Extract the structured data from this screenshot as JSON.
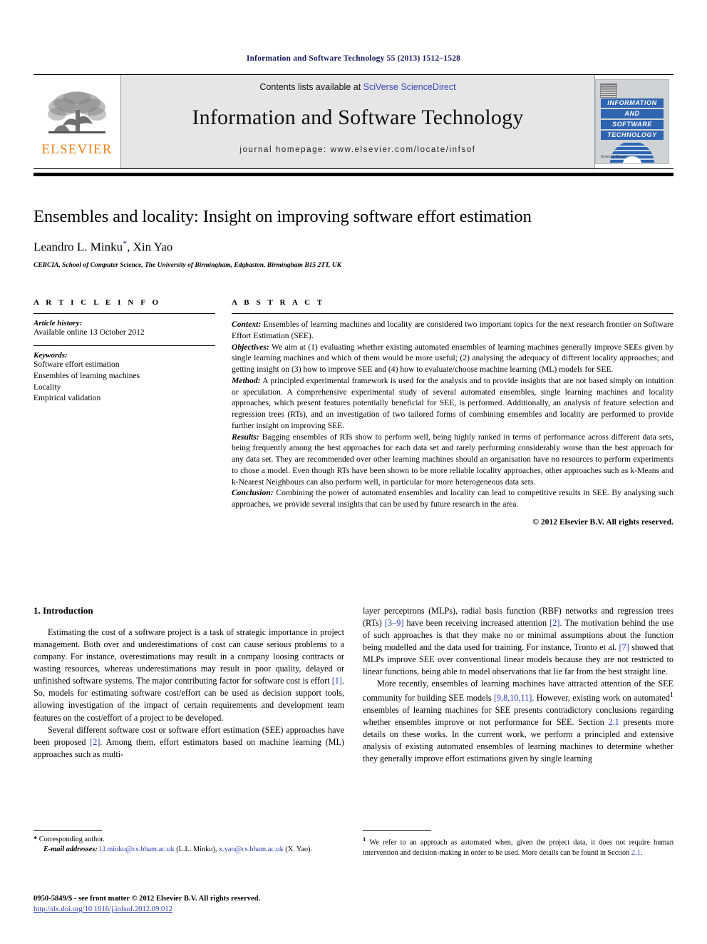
{
  "running_head": "Information and Software Technology 55 (2013) 1512–1528",
  "masthead": {
    "publisher_name": "ELSEVIER",
    "contents_prefix": "Contents lists available at ",
    "contents_link": "SciVerse ScienceDirect",
    "journal_title": "Information and Software Technology",
    "homepage_label": "journal homepage: www.elsevier.com/locate/infsof",
    "cover": {
      "band1": "INFORMATION",
      "band2": "AND",
      "band3": "SOFTWARE",
      "band4": "TECHNOLOGY",
      "footer": "Science Direct"
    }
  },
  "article": {
    "title": "Ensembles and locality: Insight on improving software effort estimation",
    "authors": "Leandro L. Minku",
    "corresponding_mark": "*",
    "authors_rest": ", Xin Yao",
    "affiliation": "CERCIA, School of Computer Science, The University of Birmingham, Edgbaston, Birmingham B15 2TT, UK"
  },
  "info": {
    "heading": "A R T I C L E   I N F O",
    "history_label": "Article history:",
    "history_value": "Available online 13 October 2012",
    "keywords_label": "Keywords:",
    "keywords": [
      "Software effort estimation",
      "Ensembles of learning machines",
      "Locality",
      "Empirical validation"
    ]
  },
  "abstract": {
    "heading": "A B S T R A C T",
    "context_label": "Context:",
    "context_text": " Ensembles of learning machines and locality are considered two important topics for the next research frontier on Software Effort Estimation (SEE).",
    "objectives_label": "Objectives:",
    "objectives_text": " We aim at (1) evaluating whether existing automated ensembles of learning machines generally improve SEEs given by single learning machines and which of them would be more useful; (2) analysing the adequacy of different locality approaches; and getting insight on (3) how to improve SEE and (4) how to evaluate/choose machine learning (ML) models for SEE.",
    "method_label": "Method:",
    "method_text": " A principled experimental framework is used for the analysis and to provide insights that are not based simply on intuition or speculation. A comprehensive experimental study of several automated ensembles, single learning machines and locality approaches, which present features potentially beneficial for SEE, is performed. Additionally, an analysis of feature selection and regression trees (RTs), and an investigation of two tailored forms of combining ensembles and locality are performed to provide further insight on improving SEE.",
    "results_label": "Results:",
    "results_text": " Bagging ensembles of RTs show to perform well, being highly ranked in terms of performance across different data sets, being frequently among the best approaches for each data set and rarely performing considerably worse than the best approach for any data set. They are recommended over other learning machines should an organisation have no resources to perform experiments to chose a model. Even though RTs have been shown to be more reliable locality approaches, other approaches such as k-Means and k-Nearest Neighbours can also perform well, in particular for more heterogeneous data sets.",
    "conclusion_label": "Conclusion:",
    "conclusion_text": " Combining the power of automated ensembles and locality can lead to competitive results in SEE. By analysing such approaches, we provide several insights that can be used by future research in the area.",
    "copyright": "© 2012 Elsevier B.V. All rights reserved."
  },
  "introduction": {
    "heading": "1. Introduction",
    "left_p1_a": "Estimating the cost of a software project is a task of strategic importance in project management. Both over and underestimations of cost can cause serious problems to a company. For instance, overestimations may result in a company loosing contracts or wasting resources, whereas underestimations may result in poor quality, delayed or unfinished software systems. The major contributing factor for software cost is effort ",
    "left_p1_ref": "[1]",
    "left_p1_b": ". So, models for estimating software cost/effort can be used as decision support tools, allowing investigation of the impact of certain requirements and development team features on the cost/effort of a project to be developed.",
    "left_p2_a": "Several different software cost or software effort estimation (SEE) approaches have been proposed ",
    "left_p2_ref": "[2]",
    "left_p2_b": ". Among them, effort estimators based on machine learning (ML) approaches such as multi-",
    "right_p1_a": "layer perceptrons (MLPs), radial basis function (RBF) networks and regression trees (RTs) ",
    "right_p1_ref1": "[3–9]",
    "right_p1_b": " have been receiving increased attention ",
    "right_p1_ref2": "[2]",
    "right_p1_c": ". The motivation behind the use of such approaches is that they make no or minimal assumptions about the function being modelled and the data used for training. For instance, Tronto et al. ",
    "right_p1_ref3": "[7]",
    "right_p1_d": " showed that MLPs improve SEE over conventional linear models because they are not restricted to linear functions, being able to model observations that lie far from the best straight line.",
    "right_p2_a": "More recently, ensembles of learning machines have attracted attention of the SEE community for building SEE models ",
    "right_p2_ref1": "[9,8,10,11]",
    "right_p2_b": ". However, existing work on automated",
    "right_p2_sup": "1",
    "right_p2_c": " ensembles of learning machines for SEE presents contradictory conclusions regarding whether ensembles improve or not performance for SEE. Section ",
    "right_p2_ref2": "2.1",
    "right_p2_d": " presents more details on these works. In the current work, we perform a principled and extensive analysis of existing automated ensembles of learning machines to determine whether they generally improve effort estimations given by single learning"
  },
  "footnotes": {
    "corresponding_mark": "*",
    "corresponding_text": " Corresponding author.",
    "email_label": "E-mail addresses:",
    "email1": "l.l.minku@cs.bham.ac.uk",
    "email1_name": " (L.L. Minku), ",
    "email2": "x.yao@cs.bham.ac.uk",
    "email2_name": " (X. Yao).",
    "right_mark": "1",
    "right_text_a": " We refer to an approach as automated when, given the project data, it does not require human intervention and decision-making in order to be used. More details can be found in Section ",
    "right_ref": "2.1",
    "right_text_b": "."
  },
  "imprint": {
    "line1": "0950-5849/$ - see front matter © 2012 Elsevier B.V. All rights reserved.",
    "doi": "http://dx.doi.org/10.1016/j.infsof.2012.09.012"
  }
}
